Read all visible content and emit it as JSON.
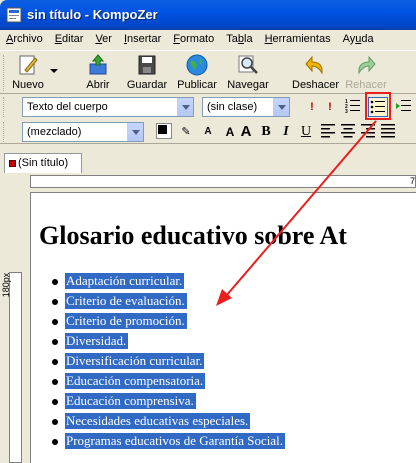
{
  "window": {
    "title": "sin título - KompoZer"
  },
  "menu": [
    {
      "pre": "",
      "ul": "A",
      "post": "rchivo"
    },
    {
      "pre": "",
      "ul": "E",
      "post": "ditar"
    },
    {
      "pre": "",
      "ul": "V",
      "post": "er"
    },
    {
      "pre": "",
      "ul": "I",
      "post": "nsertar"
    },
    {
      "pre": "",
      "ul": "F",
      "post": "ormato"
    },
    {
      "pre": "Ta",
      "ul": "b",
      "post": "la"
    },
    {
      "pre": "",
      "ul": "H",
      "post": "erramientas"
    },
    {
      "pre": "Ay",
      "ul": "u",
      "post": "da"
    }
  ],
  "toolbar": {
    "new_label": "Nuevo",
    "open_label": "Abrir",
    "save_label": "Guardar",
    "publish_label": "Publicar",
    "browse_label": "Navegar",
    "undo_label": "Deshacer",
    "redo_label": "Rehacer"
  },
  "format_bar": {
    "paragraph_format": "Texto del cuerpo",
    "class": "(sin clase)",
    "font": "(mezclado)"
  },
  "tab": {
    "label": "(Sin título)"
  },
  "ruler": {
    "marker": "7"
  },
  "side_ruler": {
    "label": "180px"
  },
  "document": {
    "title": "Glosario educativo sobre At",
    "items": [
      "Adaptación curricular.",
      "Criterio de evaluación.",
      "Criterio de promoción.",
      "Diversidad.",
      "Diversificación curricular.",
      "Educación compensatoria.",
      "Educación comprensiva.",
      "Necesidades educativas especiales.",
      "Programas educativos de Garantía Social."
    ]
  },
  "colors": {
    "selection": "#316ac5",
    "annotation": "#e82020",
    "titlebar": "#0054e3"
  }
}
